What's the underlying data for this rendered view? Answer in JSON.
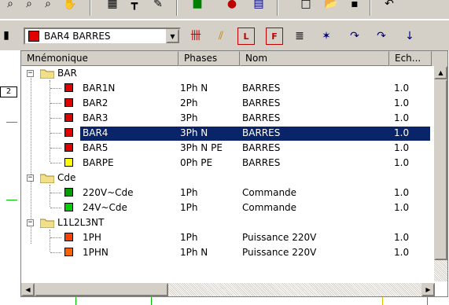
{
  "toolbar": {
    "combo_value": "BAR4 BARRES",
    "combo_color": "#e00000"
  },
  "ruler_mark": "2",
  "columns": {
    "mnemonic": "Mnémonique",
    "phases": "Phases",
    "nom": "Nom",
    "ech": "Ech..."
  },
  "tree": {
    "groups": [
      {
        "label": "BAR"
      },
      {
        "label": "Cde"
      },
      {
        "label": "L1L2L3NT"
      }
    ],
    "items": [
      {
        "mnemonic": "BAR1N",
        "phases": "1Ph N",
        "nom": "BARRES",
        "ech": "1.0",
        "color": "#e00000"
      },
      {
        "mnemonic": "BAR2",
        "phases": "2Ph",
        "nom": "BARRES",
        "ech": "1.0",
        "color": "#e00000"
      },
      {
        "mnemonic": "BAR3",
        "phases": "3Ph",
        "nom": "BARRES",
        "ech": "1.0",
        "color": "#e00000"
      },
      {
        "mnemonic": "BAR4",
        "phases": "3Ph N",
        "nom": "BARRES",
        "ech": "1.0",
        "color": "#e00000"
      },
      {
        "mnemonic": "BAR5",
        "phases": "3Ph N PE",
        "nom": "BARRES",
        "ech": "1.0",
        "color": "#e00000"
      },
      {
        "mnemonic": "BARPE",
        "phases": "0Ph PE",
        "nom": "BARRES",
        "ech": "1.0",
        "color": "#ffff00"
      },
      {
        "mnemonic": "220V~Cde",
        "phases": "1Ph",
        "nom": "Commande",
        "ech": "1.0",
        "color": "#00a000"
      },
      {
        "mnemonic": "24V~Cde",
        "phases": "1Ph",
        "nom": "Commande",
        "ech": "1.0",
        "color": "#00d000"
      },
      {
        "mnemonic": "1PH",
        "phases": "1Ph",
        "nom": "Puissance 220V",
        "ech": "1.0",
        "color": "#ff4000"
      },
      {
        "mnemonic": "1PHN",
        "phases": "1Ph N",
        "nom": "Puissance 220V",
        "ech": "1.0",
        "color": "#ff6000"
      }
    ]
  }
}
